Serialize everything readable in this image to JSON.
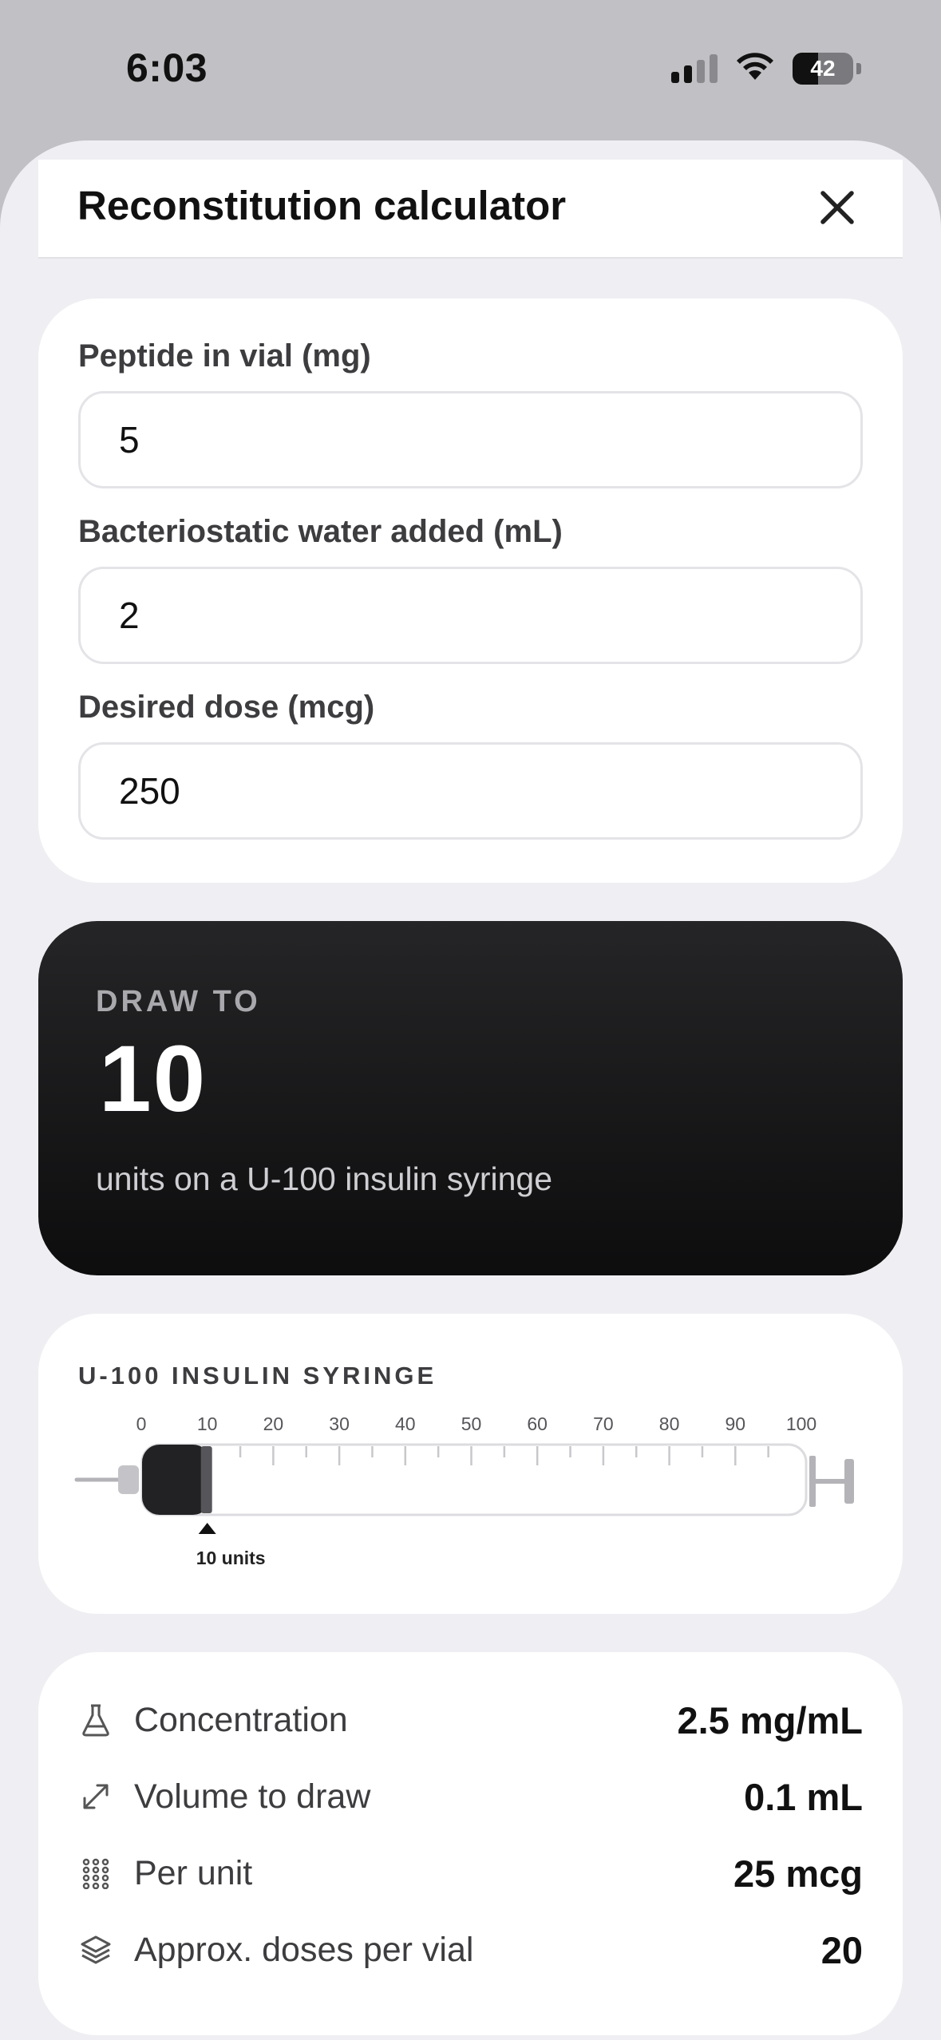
{
  "status_bar": {
    "time": "6:03",
    "battery": "42"
  },
  "sheet": {
    "title": "Reconstitution calculator",
    "close_icon": "close-icon"
  },
  "inputs": {
    "peptide_label": "Peptide in vial (mg)",
    "peptide_value": "5",
    "water_label": "Bacteriostatic water added (mL)",
    "water_value": "2",
    "dose_label": "Desired dose (mcg)",
    "dose_value": "250"
  },
  "draw": {
    "label": "DRAW TO",
    "value": "10",
    "subtitle": "units on a U-100 insulin syringe"
  },
  "syringe": {
    "title": "U-100 INSULIN SYRINGE",
    "scale_labels": [
      "0",
      "10",
      "20",
      "30",
      "40",
      "50",
      "60",
      "70",
      "80",
      "90",
      "100"
    ],
    "max_units": 100,
    "fill_units": 10,
    "marker_value": "10",
    "marker_unit": "units"
  },
  "stats": [
    {
      "icon": "flask-icon",
      "label": "Concentration",
      "value": "2.5 mg/mL"
    },
    {
      "icon": "diagonal-arrows-icon",
      "label": "Volume to draw",
      "value": "0.1 mL"
    },
    {
      "icon": "dot-grid-icon",
      "label": "Per unit",
      "value": "25 mcg"
    },
    {
      "icon": "layers-icon",
      "label": "Approx. doses per vial",
      "value": "20"
    }
  ],
  "colors": {
    "sheet_bg": "#efeff3",
    "card_bg": "#ffffff",
    "draw_card_bg": "#111112",
    "accent_dark": "#111111"
  }
}
